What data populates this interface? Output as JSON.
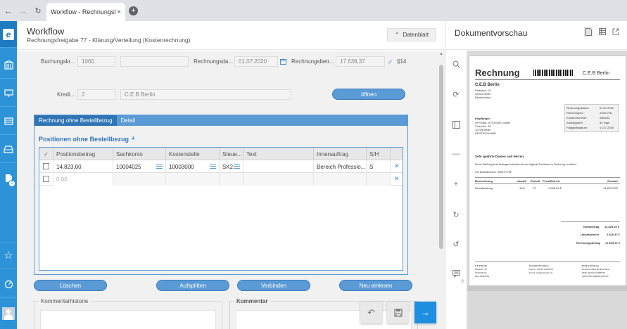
{
  "browser": {
    "tab_title": "Workflow - Rechnungsfrei...",
    "tab_close": "×",
    "new_tab": "+"
  },
  "sidebar": {
    "logo": "e",
    "badge": "1"
  },
  "header": {
    "title": "Workflow",
    "subtitle": "Rechnungsfreigabe 77 - Klärung/Verteilung (Kostenrechnung)",
    "datenblatt": "Datenblatt"
  },
  "form": {
    "buchungskreis_label": "Buchungskr...",
    "buchungskreis_value": "1000",
    "rechnungsdatum_label": "Rechnungsda...",
    "rechnungsdatum_value": "01.07.2020",
    "rechnungsbetrag_label": "Rechnungsbetr...",
    "rechnungsbetrag_value": "17.639,37",
    "rechnungsbetrag_code": "§14",
    "kreditor_label": "Kredi...",
    "kreditor_value": "2",
    "kreditor_name": "C.E.B Berlin",
    "oeffnen": "öffnen"
  },
  "tabs": [
    {
      "label": "Rechnung ohne Bestellbezug"
    },
    {
      "label": "Detail"
    }
  ],
  "positions": {
    "title": "Positionen ohne Bestellbezug",
    "add": "+",
    "columns": [
      "Positionsbetrag",
      "Sachkonto",
      "Kostenstelle",
      "Steue...",
      "Text",
      "Innenauftrag",
      "S/H"
    ],
    "rows": [
      {
        "betrag": "14.823,00",
        "sachkonto": "10004025",
        "kostenstelle": "10003000",
        "steuer": "SK2",
        "text": "",
        "innenauftrag": "Bereich Professio...",
        "sh": "S"
      },
      {
        "betrag": "0,00",
        "sachkonto": "",
        "kostenstelle": "",
        "steuer": "",
        "text": "",
        "innenauftrag": "",
        "sh": ""
      }
    ]
  },
  "actions": {
    "loeschen": "Löschen",
    "aufsplitten": "Aufsplitten",
    "verbinden": "Verbinden",
    "neu_einlesen": "Neu einlesen"
  },
  "sections": {
    "kommentarhistorie": "Kommentarhistorie",
    "kommentar": "Kommentar"
  },
  "preview": {
    "title": "Dokumentvorschau",
    "doc": {
      "heading": "Rechnung",
      "company_top": "C.E.B Berlin",
      "sender_name": "C.E.B Berlin",
      "sender_lines": [
        "Klosterpl. 15",
        "12001 Berlin",
        "Deutschland"
      ],
      "recipient_label": "Empfänger:",
      "recipient_lines": [
        "OPTIMAL SYSTEMS GmbH",
        "Cicerostr. 26",
        "10709 Berlin",
        "DEUTSCHLAND"
      ],
      "meta": [
        [
          "Rechnungsdatum:",
          "01.07.2020"
        ],
        [
          "Rechnungsnr.:",
          "2020-07B"
        ],
        [
          "Kundennummer:",
          "AB0242"
        ],
        [
          "Zahlungsziel:",
          "30 Tage"
        ],
        [
          "Fälligkeitsdatum:",
          "01.07.2020"
        ]
      ],
      "greeting": "Sehr geehrte Damen und Herren,",
      "intro": "für die Erfüllung Ihres Auftrages erlauben wir uns folgende Positionen in Rechnung zu stellen:",
      "ref": "Ihre Bestellnummer: 4500177780",
      "table_head": [
        "Bezeichnung",
        "Anzahl",
        "Einheit",
        "Preis/Einheit",
        "Gesamt"
      ],
      "table_row": [
        "Dienstleistung",
        "13,5",
        "PT",
        "1.098,00 €",
        "14.823,00 €"
      ],
      "totals": [
        [
          "Nettobetrag",
          "14.823,00 €"
        ],
        [
          "Umsatzsteuer",
          "2.816,37 €"
        ],
        [
          "Rechnungsbetrag",
          "17.639,37 €"
        ]
      ],
      "footer_cols": [
        [
          "C.E.B Berlin",
          "Klosterpl. 15",
          "12001 Berlin",
          "DE 123456789"
        ],
        [
          "Kontaktinformation",
          "Phone: +49 30 12345678",
          "Email: info@cebberlin.de"
        ],
        [
          "Bankverbindung",
          "Deutsche Bank  Berliner Bank",
          "IBAN  DE23A1234B5678",
          "SWIFT/BIC  DEBAN1X9XXX"
        ]
      ]
    },
    "comment_count": "0"
  }
}
